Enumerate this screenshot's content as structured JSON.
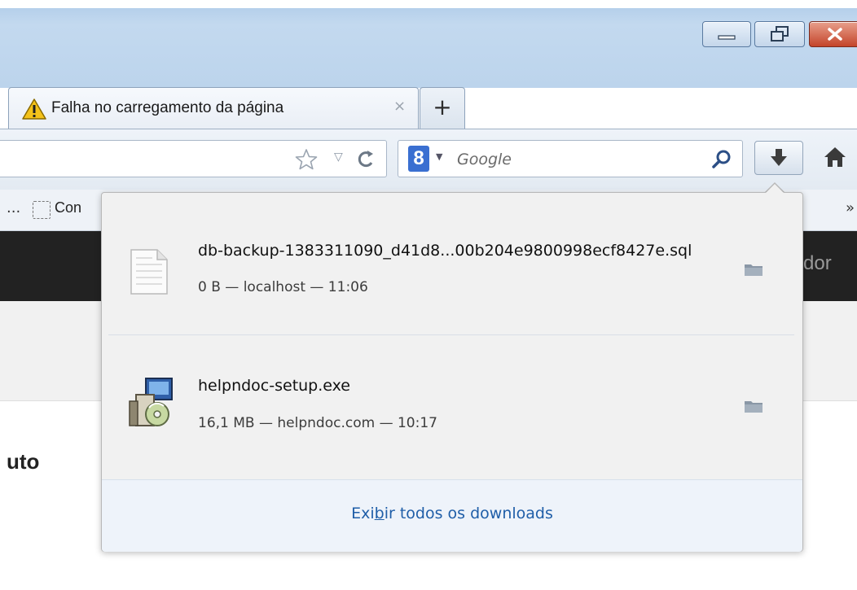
{
  "window": {
    "controls": [
      "minimize",
      "restore",
      "close"
    ]
  },
  "tabs": [
    {
      "title": "Falha no carregamento da página",
      "icon": "warning-icon",
      "close": "×"
    }
  ],
  "new_tab": "+",
  "search": {
    "engine": "Google",
    "placeholder": "Google"
  },
  "bookmarks": {
    "leading": "...",
    "item_label": "Con",
    "overflow": "»"
  },
  "page": {
    "header_fragment": "dor",
    "body_fragment": "uto"
  },
  "downloads_panel": {
    "items": [
      {
        "name": "db-backup-1383311090_d41d8...00b204e9800998ecf8427e.sql",
        "meta": "0 B — localhost — 11:06",
        "icon": "text-file-icon"
      },
      {
        "name": "helpndoc-setup.exe",
        "meta": "16,1 MB — helpndoc.com — 10:17",
        "icon": "installer-icon"
      }
    ],
    "show_all_pre": "Exi",
    "show_all_underline": "b",
    "show_all_post": "ir todos os downloads"
  },
  "colors": {
    "titlebar": "#bcd4ec",
    "link": "#1f5ea8",
    "site_header": "#222222"
  }
}
